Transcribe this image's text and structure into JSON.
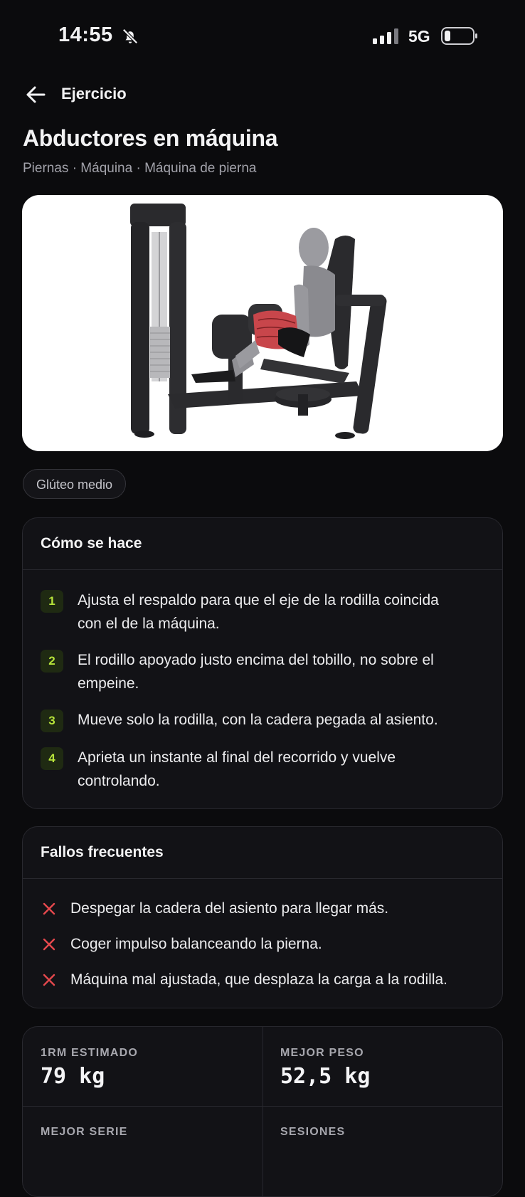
{
  "status_bar": {
    "time": "14:55",
    "network": "5G",
    "icons": [
      "bell-off-icon",
      "signal-icon",
      "battery-icon"
    ]
  },
  "header": {
    "back_icon": "arrow-left-icon",
    "title": "Ejercicio"
  },
  "exercise": {
    "name": "Abductores en máquina",
    "subtitle": "Piernas · Máquina · Máquina de pierna",
    "muscle": "Glúteo medio"
  },
  "how_to": {
    "title": "Cómo se hace",
    "steps": [
      {
        "n": "1",
        "line1": "Ajusta el respaldo para que el eje de la rodilla coincida",
        "line2": "con el de la máquina."
      },
      {
        "n": "2",
        "line1": "El rodillo apoyado justo encima del tobillo, no sobre el",
        "line2": "empeine."
      },
      {
        "n": "3",
        "line1": "Mueve solo la rodilla, con la cadera pegada al asiento.",
        "line2": ""
      },
      {
        "n": "4",
        "line1": "Aprieta un instante al final del recorrido y vuelve",
        "line2": "controlando."
      }
    ]
  },
  "mistakes": {
    "title": "Fallos frecuentes",
    "items": [
      "Despegar la cadera del asiento para llegar más.",
      "Coger impulso balanceando la pierna.",
      "Máquina mal ajustada, que desplaza la carga a la rodilla."
    ]
  },
  "stats": {
    "one_rm": {
      "label": "1RM ESTIMADO",
      "value": "79 kg"
    },
    "best_weight": {
      "label": "MEJOR PESO",
      "value": "52,5 kg"
    },
    "best_set": {
      "label": "MEJOR SERIE",
      "value": ""
    },
    "sessions": {
      "label": "SESIONES",
      "value": ""
    }
  },
  "colors": {
    "background": "#0b0b0d",
    "card": "#121216",
    "accent": "#b7e43a",
    "danger": "#e5484d"
  }
}
